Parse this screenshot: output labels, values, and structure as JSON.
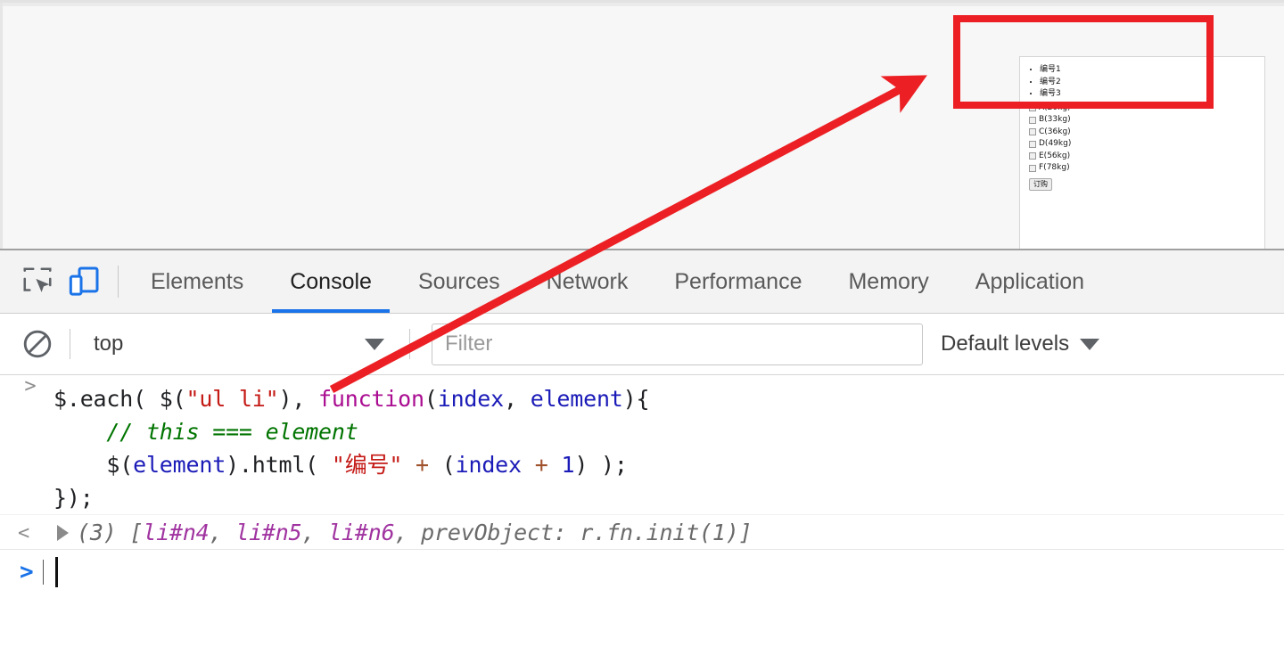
{
  "page": {
    "list_items": [
      "编号1",
      "编号2",
      "编号3"
    ],
    "checkbox_items": [
      "A(20kg)",
      "B(33kg)",
      "C(36kg)",
      "D(49kg)",
      "E(56kg)",
      "F(78kg)"
    ],
    "order_button_label": "订购"
  },
  "devtools": {
    "icons": {
      "inspect": "inspect-element-icon",
      "device": "device-toolbar-icon",
      "clear": "clear-console-icon"
    },
    "tabs": [
      {
        "label": "Elements",
        "active": false
      },
      {
        "label": "Console",
        "active": true
      },
      {
        "label": "Sources",
        "active": false
      },
      {
        "label": "Network",
        "active": false
      },
      {
        "label": "Performance",
        "active": false
      },
      {
        "label": "Memory",
        "active": false
      },
      {
        "label": "Application",
        "active": false
      }
    ],
    "active_tab": "Console",
    "accent_color": "#1a73e8",
    "filterbar": {
      "context_value": "top",
      "filter_placeholder": "Filter",
      "filter_value": "",
      "levels_value": "Default levels"
    },
    "console": {
      "prompt_glyph": ">",
      "input_glyph": ">",
      "result_glyph": "<",
      "code": {
        "line1": {
          "p1": "$.each( $(",
          "str": "\"ul li\"",
          "p2": "), ",
          "kw": "function",
          "p3": "(",
          "v1": "index",
          "p4": ", ",
          "v2": "element",
          "p5": "){"
        },
        "line2": {
          "indent": "    ",
          "comment": "// this === element"
        },
        "line3": {
          "indent": "    ",
          "p1": "$(",
          "v1": "element",
          "p2": ").html( ",
          "str": "\"编号\"",
          "op1": " + ",
          "p3": "(",
          "v2": "index",
          "op2": " + ",
          "num": "1",
          "p4": ") );"
        },
        "line4": "});"
      },
      "result": {
        "count": "(3)",
        "open": " [",
        "el1": "li#n4",
        "sep1": ", ",
        "el2": "li#n5",
        "sep2": ", ",
        "el3": "li#n6",
        "tail": ", prevObject: r.fn.init(1)]"
      }
    }
  },
  "annotation": {
    "highlight_color": "#ec2024",
    "shapes": [
      "red-rectangle",
      "red-arrow"
    ]
  }
}
